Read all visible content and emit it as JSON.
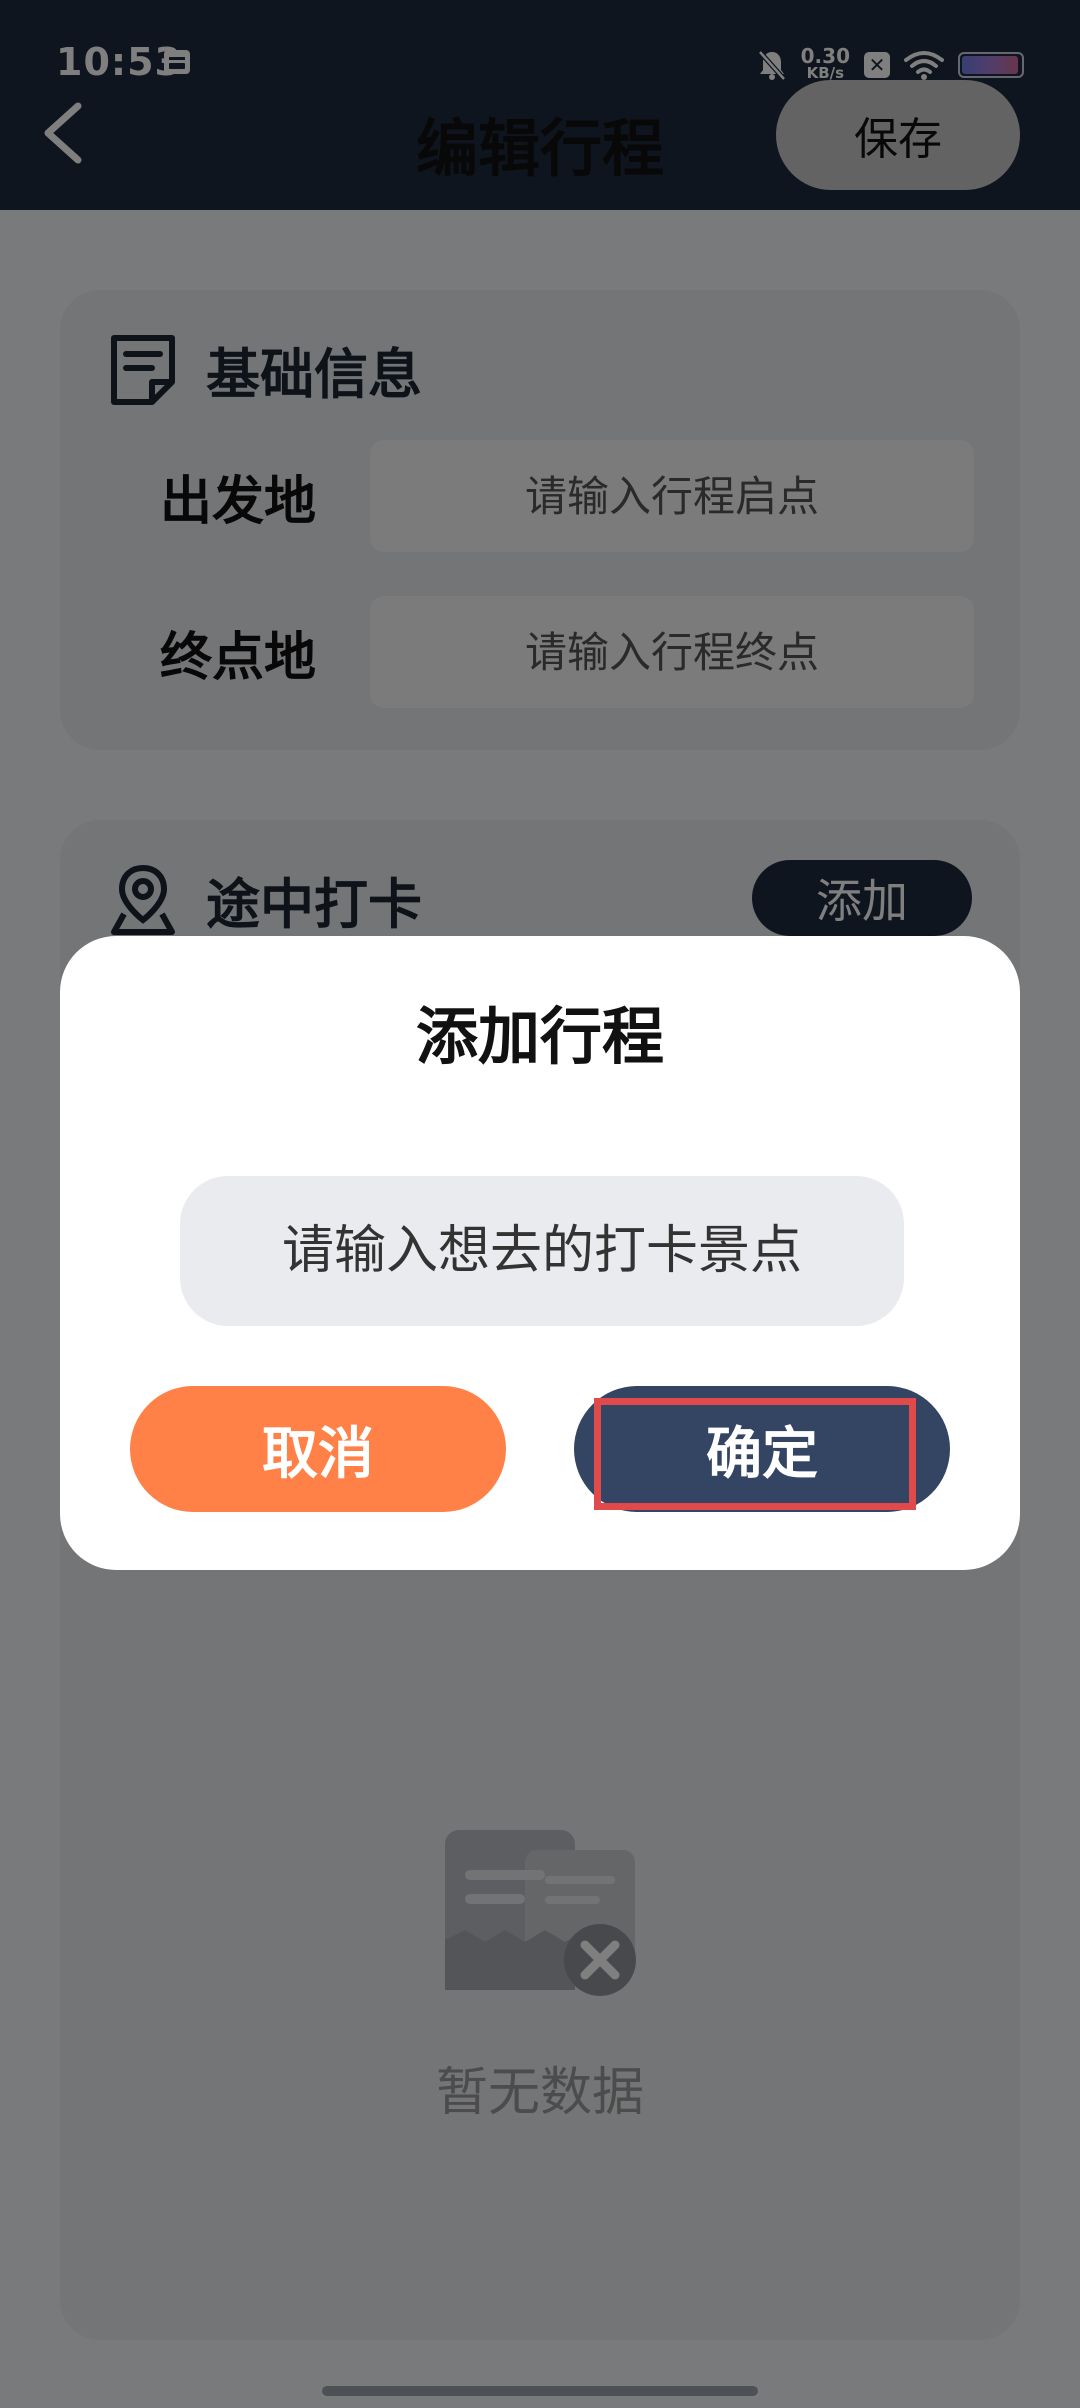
{
  "status_bar": {
    "time": "10:53",
    "net_speed_value": "0.30",
    "net_speed_unit": "KB/s",
    "icons": [
      "calendar-icon",
      "bell-muted-icon",
      "x-app-icon",
      "wifi-icon",
      "battery-icon"
    ]
  },
  "header": {
    "title": "编辑行程",
    "save_label": "保存"
  },
  "basic_info": {
    "title": "基础信息",
    "fields": [
      {
        "label": "出发地",
        "placeholder": "请输入行程启点"
      },
      {
        "label": "终点地",
        "placeholder": "请输入行程终点"
      }
    ]
  },
  "stops": {
    "title": "途中打卡",
    "add_label": "添加",
    "empty_text": "暂无数据"
  },
  "dialog": {
    "title": "添加行程",
    "input_placeholder": "请输入想去的打卡景点",
    "cancel_label": "取消",
    "confirm_label": "确定"
  },
  "colors": {
    "header_bg": "#1f2a3c",
    "cancel_bg": "#ff8148",
    "confirm_bg": "#334563",
    "highlight": "#e14a4a"
  }
}
